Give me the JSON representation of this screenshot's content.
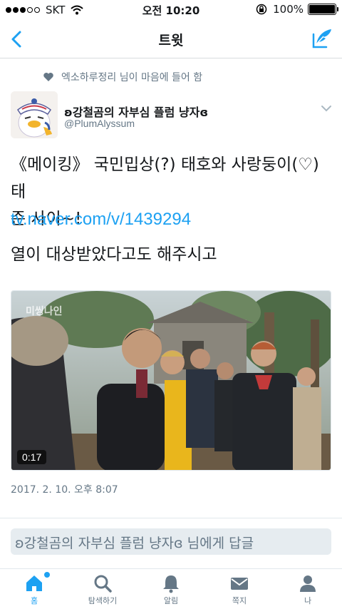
{
  "status_bar": {
    "carrier": "SKT",
    "time": "오전 10:20",
    "battery": "100%"
  },
  "nav": {
    "title": "트윗"
  },
  "liked_by": "엑소하루정리 님이 마음에 들어 함",
  "author": {
    "name": "ʚ강철곰의 자부심 플럼 냥자ɞ",
    "handle": "@PlumAlyssum"
  },
  "tweet": {
    "text_line1": "《메이킹》 국민밉상(?) 태호와 사랑둥이(♡) 태",
    "text_line2": "준 사이~!",
    "link": "tv.naver.com/v/1439294",
    "text_line3": "열이 대상받았다고도 해주시고",
    "video_duration": "0:17",
    "video_watermark": "미씽나인",
    "timestamp": "2017. 2. 10. 오후 8:07"
  },
  "reply_placeholder": "ʚ강철곰의 자부심 플럼 냥자ɞ 님에게 답글",
  "tabs": [
    {
      "label": "홈",
      "icon": "home-icon"
    },
    {
      "label": "탐색하기",
      "icon": "search-icon"
    },
    {
      "label": "알림",
      "icon": "bell-icon"
    },
    {
      "label": "쪽지",
      "icon": "envelope-icon"
    },
    {
      "label": "나",
      "icon": "person-icon"
    }
  ],
  "colors": {
    "accent": "#1da1f2",
    "muted": "#657786"
  }
}
